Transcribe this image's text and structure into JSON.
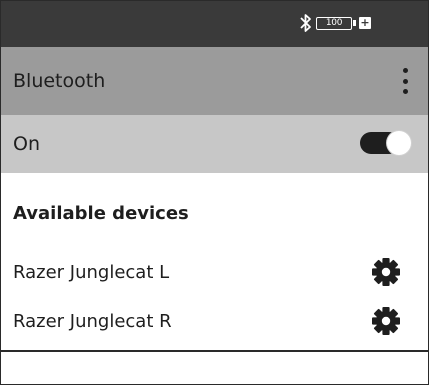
{
  "status_bar": {
    "bluetooth_icon": "bluetooth-icon",
    "battery_level": "100",
    "battery_plus": "+"
  },
  "header": {
    "title": "Bluetooth",
    "menu_icon": "more-vertical-icon"
  },
  "power_row": {
    "label": "On",
    "toggle_state": true
  },
  "devices_section": {
    "title": "Available devices",
    "devices": [
      {
        "name": "Razer Junglecat L",
        "settings_icon": "gear-icon"
      },
      {
        "name": "Razer Junglecat R",
        "settings_icon": "gear-icon"
      }
    ]
  },
  "colors": {
    "status_bar": "#3a3a3a",
    "header": "#9b9b9b",
    "power_row": "#c7c7c7",
    "text": "#1e1e1e",
    "toggle_track": "#1e1e1e"
  }
}
